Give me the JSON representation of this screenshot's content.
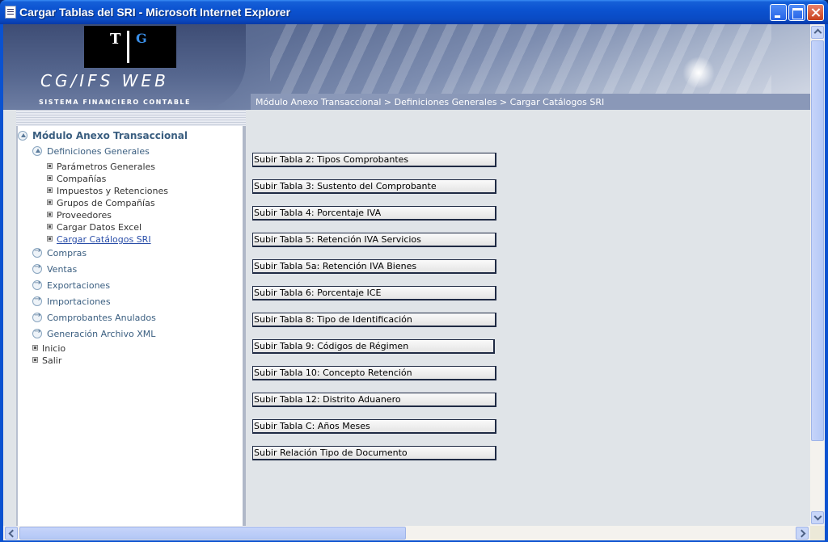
{
  "window": {
    "title": "Cargar Tablas del SRI - Microsoft Internet Explorer"
  },
  "banner": {
    "logo_t": "T",
    "logo_g": "G",
    "brand": "CG/IFS WEB",
    "subtitle": "SISTEMA FINANCIERO CONTABLE"
  },
  "breadcrumb": "Módulo Anexo Transaccional > Definiciones Generales > Cargar Catálogos SRI",
  "sidebar": {
    "root": "Módulo Anexo Transaccional",
    "group": "Definiciones Generales",
    "sub_items": [
      "Parámetros Generales",
      "Compañías",
      "Impuestos y Retenciones",
      "Grupos de Compañías",
      "Proveedores",
      "Cargar Datos Excel",
      "Cargar Catálogos SRI"
    ],
    "sections": [
      "Compras",
      "Ventas",
      "Exportaciones",
      "Importaciones",
      "Comprobantes Anulados",
      "Generación Archivo XML"
    ],
    "misc": [
      "Inicio",
      "Salir"
    ]
  },
  "buttons": [
    "Subir Tabla 2: Tipos Comprobantes",
    "Subir Tabla 3: Sustento del Comprobante",
    "Subir Tabla 4: Porcentaje IVA",
    "Subir Tabla 5: Retención IVA Servicios",
    "Subir Tabla 5a: Retención IVA Bienes",
    "Subir Tabla 6: Porcentaje ICE",
    "Subir Tabla 8: Tipo de Identificación",
    "Subir Tabla 9: Códigos de Régimen",
    "Subir Tabla 10: Concepto Retención",
    "Subir Tabla 12: Distrito Aduanero",
    "Subir Tabla C: Años Meses",
    "Subir Relación Tipo de Documento"
  ],
  "icons": {
    "window": "ie-page-icon",
    "minimize": "minimize-icon",
    "maximize": "maximize-icon",
    "close": "close-icon",
    "expanded": "collapse-up-icon",
    "section": "arrow-right-icon",
    "bullet": "square-bullet-icon"
  },
  "colors": {
    "title_bar": "#0b52d0",
    "nav_link": "#3a5e80",
    "current_link": "#2a4ea8",
    "content_bg": "#e0e4e8"
  }
}
